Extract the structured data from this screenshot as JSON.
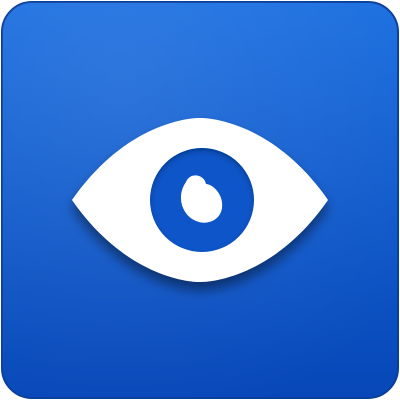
{
  "app_icon": {
    "icon": "eye-icon",
    "colors": {
      "tile_top": "#1a6ee0",
      "tile_bottom": "#0747b8",
      "tile_border": "#0a3f9e",
      "glyph": "#ffffff",
      "iris": "#0a55c8",
      "shadow": "#00205a"
    }
  }
}
